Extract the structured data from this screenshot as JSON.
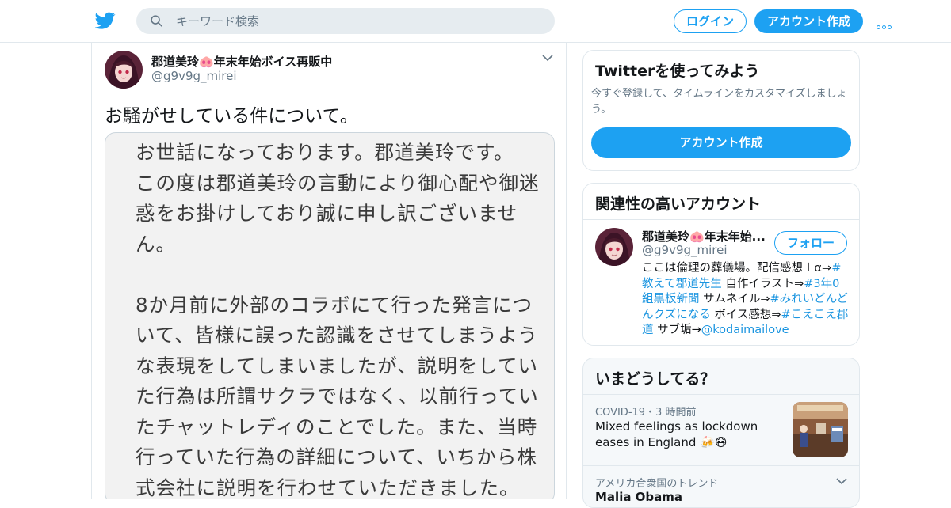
{
  "header": {
    "search_placeholder": "キーワード検索",
    "login_label": "ログイン",
    "signup_label": "アカウント作成",
    "brand_color": "#1da1f2"
  },
  "tweet": {
    "author_name": "郡道美玲🐽年末年始ボイス再販中",
    "author_handle": "@g9v9g_mirei",
    "text": "お騒がせしている件について。",
    "image_lines": [
      "お世話になっております。郡道美玲です。",
      "この度は郡道美玲の言動により御心配や御迷",
      "惑をお掛けしており誠に申し訳ございませ",
      "ん。",
      "",
      "8か月前に外部のコラボにて行った発言につ",
      "いて、皆様に誤った認識をさせてしまうよう",
      "な表現をしてしまいましたが、説明をしてい",
      "た行為は所謂サクラではなく、以前行ってい",
      "たチャットレディのことでした。また、当時",
      "行っていた行為の詳細について、いちから株",
      "式会社に説明を行わせていただきました。"
    ]
  },
  "sidebar": {
    "signup_card": {
      "title": "Twitterを使ってみよう",
      "description": "今すぐ登録して、タイムラインをカスタマイズしましょう。",
      "cta_label": "アカウント作成"
    },
    "related": {
      "title": "関連性の高いアカウント",
      "name": "郡道美玲🐽年末年始...",
      "handle": "@g9v9g_mirei",
      "follow_label": "フォロー",
      "bio_1": "ここは倫理の葬儀場。配信感想＋α⇒",
      "bio_tag_1": "#教えて郡道先生",
      "bio_2": " 自作イラスト⇒",
      "bio_tag_2": "#3年0組黒板新聞",
      "bio_3": " サムネイル⇒",
      "bio_tag_3": "#みれいどんどんクズになる",
      "bio_4": " ボイス感想⇒",
      "bio_tag_4": "#こえこえ郡道",
      "bio_5": " サブ垢→",
      "bio_mention": "@kodaimailove"
    },
    "trends": {
      "title": "いまどうしてる？",
      "item1_meta": "COVID-19・3 時間前",
      "item1_title": "Mixed feelings as lockdown eases in England 🍻😷",
      "item2_meta": "アメリカ合衆国のトレンド",
      "item2_title": "Malia Obama"
    }
  },
  "icons": {
    "logo": "twitter-bird-icon",
    "search": "search-icon",
    "more": "more-dots-icon",
    "caret": "chevron-down-icon"
  }
}
